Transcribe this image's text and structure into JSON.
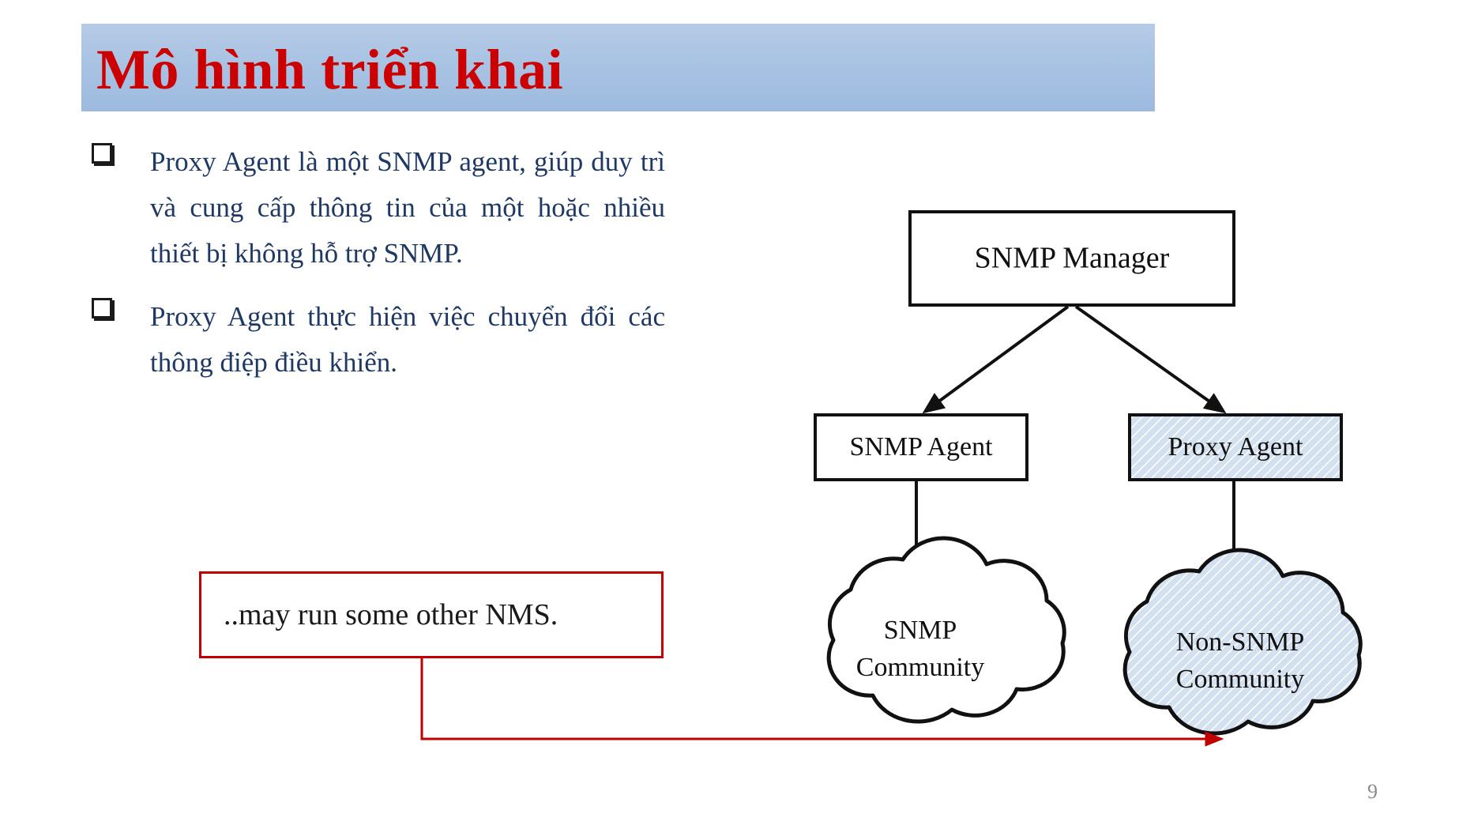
{
  "slide": {
    "title": "Mô hình triển khai",
    "page_number": "9",
    "title_color": "#cc0000",
    "title_bar_color": "#a9c3e3",
    "body_text_color": "#1f3864",
    "callout_border_color": "#c00000",
    "accent_fill_color": "#cfdcea"
  },
  "bullets": [
    {
      "marker": "hollow-square",
      "text": "Proxy Agent là một SNMP agent, giúp duy trì và cung cấp thông tin của một hoặc nhiều thiết bị không hỗ trợ SNMP."
    },
    {
      "marker": "hollow-square",
      "text": "Proxy Agent thực hiện việc chuyển đổi các thông điệp điều khiển."
    }
  ],
  "callout": {
    "text": "..may run some other NMS."
  },
  "diagram": {
    "nodes": {
      "manager": {
        "label": "SNMP Manager",
        "fill": "white"
      },
      "snmp_agent": {
        "label": "SNMP Agent",
        "fill": "white"
      },
      "proxy_agent": {
        "label": "Proxy Agent",
        "fill": "hatched-blue"
      },
      "snmp_cloud_line1": "SNMP",
      "snmp_cloud_line2": "Community",
      "nonsnmp_cloud_line1": "Non-SNMP",
      "nonsnmp_cloud_line2": "Community"
    }
  }
}
